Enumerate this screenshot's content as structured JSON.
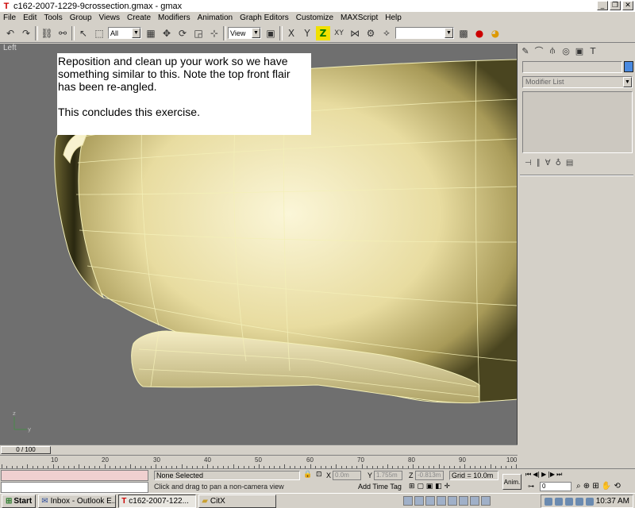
{
  "window": {
    "title": "c162-2007-1229-9crossection.gmax - gmax"
  },
  "menu": {
    "items": [
      "File",
      "Edit",
      "Tools",
      "Group",
      "Views",
      "Create",
      "Modifiers",
      "Animation",
      "Graph Editors",
      "Customize",
      "MAXScript",
      "Help"
    ]
  },
  "toolbar": {
    "selection_filter": "All",
    "reference_coord": "View",
    "named_selection": ""
  },
  "viewport": {
    "label": "Left",
    "note_line1": "Reposition and clean up your work so we have something similar to this.  Note the top front flair has been re-angled.",
    "note_line2": "This concludes this exercise."
  },
  "command_panel": {
    "modifier_list": "Modifier List",
    "object_color": "#4a8ae0"
  },
  "time_slider": {
    "label": "0 / 100"
  },
  "timeline": {
    "ticks": [
      "10",
      "20",
      "30",
      "40",
      "50",
      "60",
      "70",
      "80",
      "90",
      "100"
    ]
  },
  "status": {
    "selection": "None Selected",
    "prompt": "Click and drag to pan a non-camera view",
    "x_label": "X",
    "x_value": "0.0m",
    "y_label": "Y",
    "y_value": "1.755m",
    "z_label": "Z",
    "z_value": "-0.813m",
    "grid": "Grid = 10.0m",
    "add_time_tag": "Add Time Tag",
    "anim": "Anim.",
    "frame": "0"
  },
  "taskbar": {
    "start": "Start",
    "tasks": [
      "Inbox - Outlook E...",
      "c162-2007-122...",
      "CitX"
    ],
    "clock": "10:37 AM"
  }
}
